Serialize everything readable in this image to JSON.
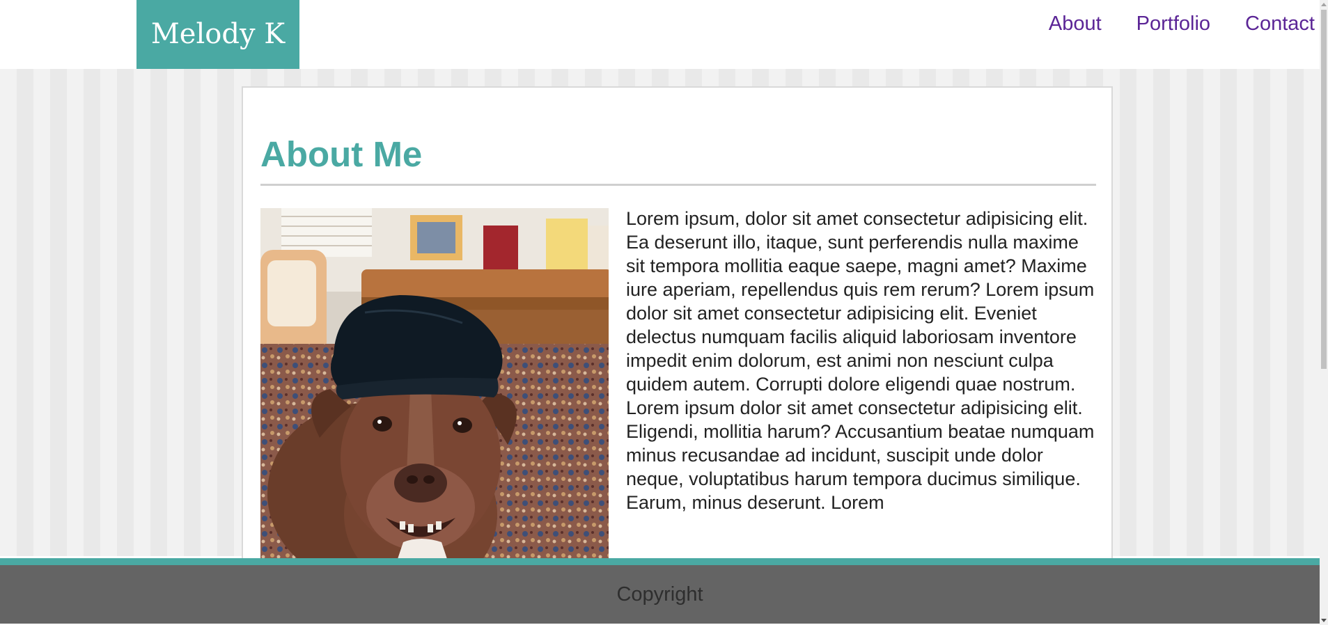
{
  "header": {
    "logo_text": "Melody K",
    "nav": [
      {
        "label": "About"
      },
      {
        "label": "Portfolio"
      },
      {
        "label": "Contact"
      }
    ]
  },
  "main": {
    "title": "About Me",
    "photo": {
      "alt": "dog wearing a black beanie"
    },
    "paragraphs": [
      "Lorem ipsum, dolor sit amet consectetur adipisicing elit. Ea deserunt illo, itaque, sunt perferendis nulla maxime sit tempora mollitia eaque saepe, magni amet? Maxime iure aperiam, repellendus quis rem rerum? Lorem ipsum dolor sit amet consectetur adipisicing elit. Eveniet delectus numquam facilis aliquid laboriosam inventore impedit enim dolorum, est animi non nesciunt culpa quidem autem. Corrupti dolore eligendi quae nostrum.",
      "Lorem ipsum dolor sit amet consectetur adipisicing elit. Eligendi, mollitia harum? Accusantium beatae numquam minus recusandae ad incidunt, suscipit unde dolor neque, voluptatibus harum tempora ducimus similique. Earum, minus deserunt. Lorem"
    ]
  },
  "footer": {
    "text": "Copyright"
  },
  "colors": {
    "accent": "#4aa9a3",
    "nav_link": "#5b2596",
    "footer_bg": "#646464"
  }
}
